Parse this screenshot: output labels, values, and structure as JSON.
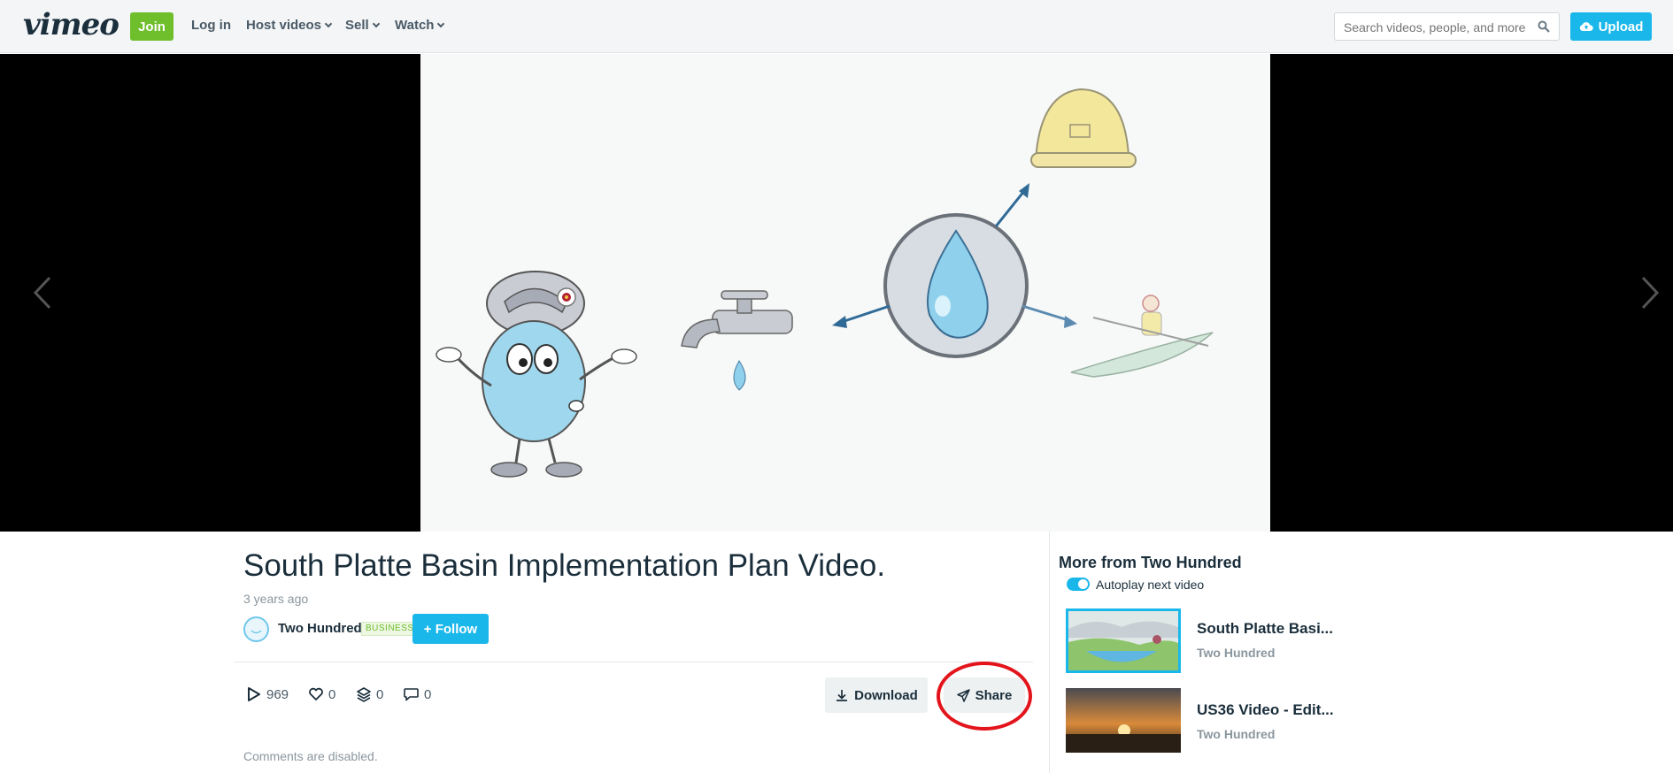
{
  "header": {
    "logo": "vimeo",
    "join_label": "Join",
    "nav": [
      {
        "label": "Log in"
      },
      {
        "label": "Host videos"
      },
      {
        "label": "Sell"
      },
      {
        "label": "Watch"
      }
    ],
    "search_placeholder": "Search videos, people, and more",
    "upload_label": "Upload"
  },
  "video": {
    "title": "South Platte Basin Implementation Plan Video.",
    "date": "3 years ago",
    "author": "Two Hundred",
    "badge": "BUSINESS",
    "follow_label": "+ Follow",
    "stats": {
      "plays": "969",
      "likes": "0",
      "collections": "0",
      "comments": "0"
    },
    "download_label": "Download",
    "share_label": "Share",
    "comments_note": "Comments are disabled."
  },
  "sidebar": {
    "more_title": "More from Two Hundred",
    "autoplay_label": "Autoplay next video",
    "autoplay_on": true,
    "related": [
      {
        "title": "South Platte Basi...",
        "author": "Two Hundred"
      },
      {
        "title": "US36 Video - Edit...",
        "author": "Two Hundred"
      }
    ]
  },
  "colors": {
    "brand_blue": "#1ab7ea",
    "join_green": "#6fbe2c",
    "highlight_red": "#e3141b"
  }
}
